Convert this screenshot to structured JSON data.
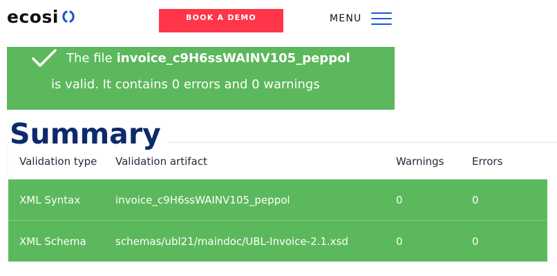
{
  "header": {
    "logo_text": "ecosi",
    "demo_button_label": "BOOK A DEMO",
    "menu_label": "MENU",
    "colors": {
      "accent": "#ff3549",
      "brand_blue": "#1a56d6",
      "logo_dark": "#111111"
    }
  },
  "banner": {
    "icon": "check-icon",
    "prefix": "The file",
    "filename": "invoice_c9H6ssWAINV105_peppol",
    "message": "is valid. It contains 0 errors and 0 warnings",
    "color": "#5cb85c"
  },
  "summary": {
    "title": "Summary",
    "title_color": "#0d2a6b",
    "columns": [
      "Validation type",
      "Validation artifact",
      "Warnings",
      "Errors"
    ],
    "rows": [
      {
        "type": "XML Syntax",
        "artifact": "invoice_c9H6ssWAINV105_peppol",
        "warnings": "0",
        "errors": "0"
      },
      {
        "type": "XML Schema",
        "artifact": "schemas/ubl21/maindoc/UBL-Invoice-2.1.xsd",
        "warnings": "0",
        "errors": "0"
      }
    ]
  }
}
